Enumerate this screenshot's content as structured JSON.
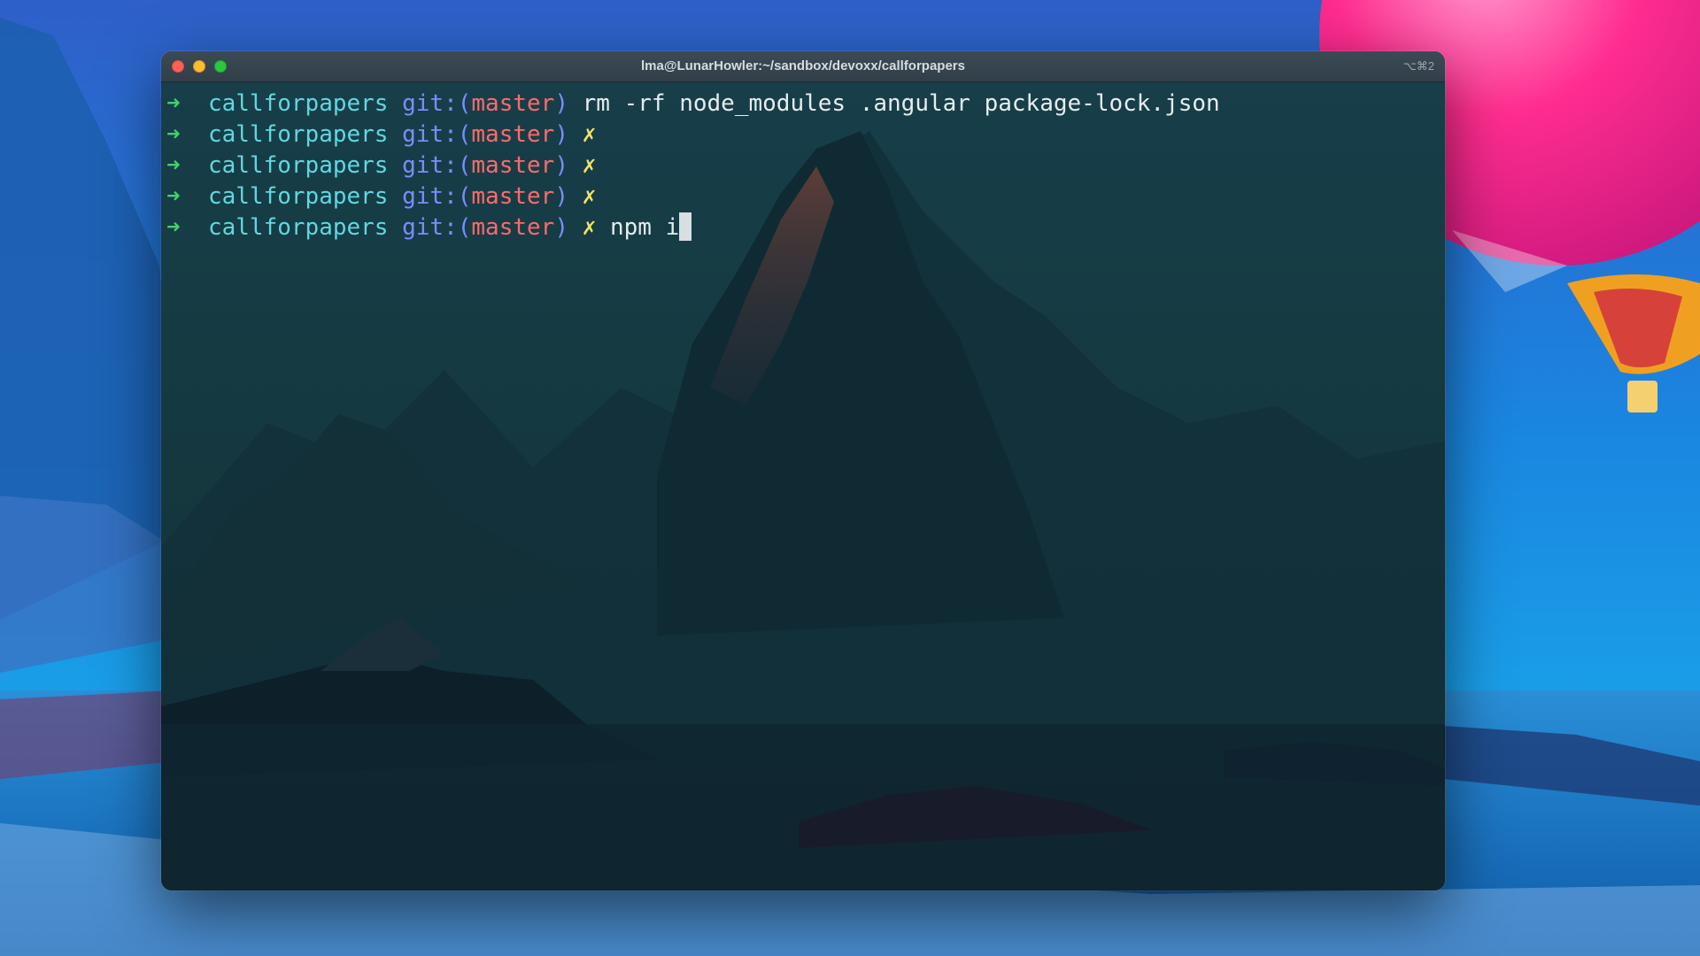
{
  "window": {
    "title": "lma@LunarHowler:~/sandbox/devoxx/callforpapers",
    "shortcut": "⌥⌘2"
  },
  "prompt": {
    "arrow": "➜",
    "directory": "callforpapers",
    "git_label": "git:(",
    "branch": "master",
    "git_close": ")",
    "dirty_marker": "✗"
  },
  "lines": [
    {
      "command": "rm -rf node_modules .angular package-lock.json",
      "dirty": false
    },
    {
      "command": "",
      "dirty": true
    },
    {
      "command": "",
      "dirty": true
    },
    {
      "command": "",
      "dirty": true
    },
    {
      "command": "npm i",
      "dirty": true,
      "cursor": true
    }
  ],
  "colors": {
    "arrow": "#45d06b",
    "directory": "#5fd8e0",
    "git": "#7d8cff",
    "branch": "#ff6a6a",
    "dirty": "#f3e36a",
    "command": "#e7ecef"
  }
}
